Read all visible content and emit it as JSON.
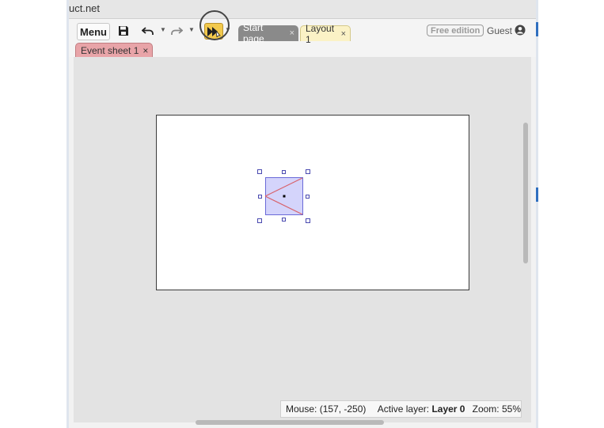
{
  "window": {
    "title": "uct.net"
  },
  "toolbar": {
    "menu_label": "Menu",
    "save_icon": "save-icon",
    "undo_icon": "undo-icon",
    "redo_icon": "redo-icon",
    "preview_icon": "play-preview-icon",
    "accent_color": "#f2c94c"
  },
  "tabs": [
    {
      "label": "Start page",
      "close": "×"
    },
    {
      "label": "Layout 1",
      "close": "×"
    }
  ],
  "subtabs": [
    {
      "label": "Event sheet 1",
      "close": "×"
    }
  ],
  "account": {
    "edition_badge": "Free edition",
    "user_label": "Guest"
  },
  "status": {
    "mouse_label": "Mouse:",
    "mouse_value": "(157, -250)",
    "layer_label": "Active layer:",
    "layer_value": "Layer 0",
    "zoom_label": "Zoom:",
    "zoom_value": "55%"
  }
}
